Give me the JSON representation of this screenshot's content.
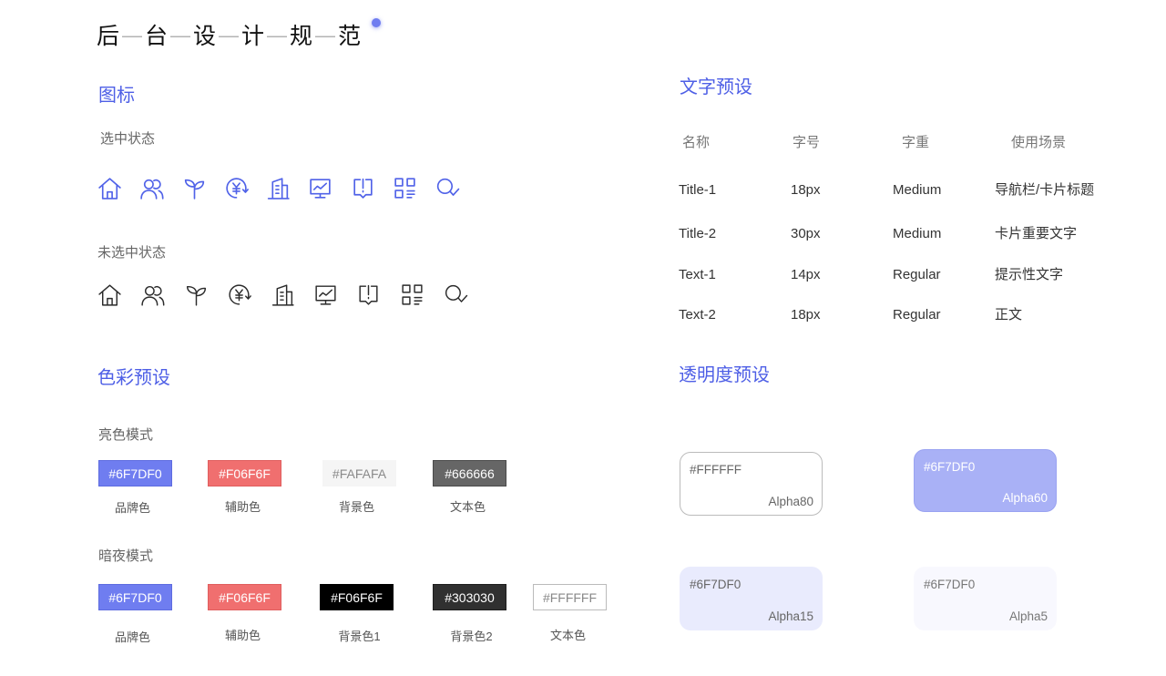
{
  "title": {
    "chars": [
      "后",
      "台",
      "设",
      "计",
      "规",
      "范"
    ],
    "separator": "—"
  },
  "colors": {
    "brand": "#6F7DF0",
    "heading": "#4E5FE6",
    "icon_selected": "#5062E8",
    "icon_unselected": "#2B2B2B"
  },
  "icons_section": {
    "heading": "图标",
    "selected_label": "选中状态",
    "unselected_label": "未选中状态",
    "selected": [
      "home-icon",
      "users-icon",
      "sprout-icon",
      "yen-refresh-icon",
      "building-icon",
      "monitor-chart-icon",
      "report-alert-icon",
      "grid-icon",
      "search-check-icon"
    ],
    "unselected": [
      "home-icon",
      "users-icon",
      "sprout-icon",
      "yen-refresh-icon",
      "building-icon",
      "monitor-chart-icon",
      "report-alert-icon",
      "grid-icon",
      "search-check-icon"
    ]
  },
  "color_section": {
    "heading": "色彩预设",
    "light": {
      "label": "亮色模式",
      "swatches": [
        {
          "hex": "#6F7DF0",
          "name": "品牌色",
          "fill": "#6F7DF0",
          "text_color": "#FFFFFF",
          "border": "#5E6CE0"
        },
        {
          "hex": "#F06F6F",
          "name": "辅助色",
          "fill": "#F06F6F",
          "text_color": "#FFFFFF",
          "border": "#E05E5E"
        },
        {
          "hex": "#FAFAFA",
          "name": "背景色",
          "fill": "#F5F5F5",
          "text_color": "#8A8A8A",
          "border": "#F5F5F5"
        },
        {
          "hex": "#666666",
          "name": "文本色",
          "fill": "#666666",
          "text_color": "#FFFFFF",
          "border": "#4A4A4A"
        }
      ]
    },
    "dark": {
      "label": "暗夜模式",
      "swatches": [
        {
          "hex": "#6F7DF0",
          "name": "品牌色",
          "fill": "#6F7DF0",
          "text_color": "#FFFFFF",
          "border": "#5E6CE0"
        },
        {
          "hex": "#F06F6F",
          "name": "辅助色",
          "fill": "#F06F6F",
          "text_color": "#FFFFFF",
          "border": "#E05E5E"
        },
        {
          "hex": "#F06F6F",
          "name": "背景色1",
          "fill": "#000000",
          "text_color": "#FFFFFF",
          "border": "#000000"
        },
        {
          "hex": "#303030",
          "name": "背景色2",
          "fill": "#303030",
          "text_color": "#FFFFFF",
          "border": "#1E1E1E"
        },
        {
          "hex": "#FFFFFF",
          "name": "文本色",
          "fill": "#FFFFFF",
          "text_color": "#888888",
          "border": "#BBBBBB"
        }
      ]
    }
  },
  "type_section": {
    "heading": "文字预设",
    "columns": [
      "名称",
      "字号",
      "字重",
      "使用场景"
    ],
    "rows": [
      [
        "Title-1",
        "18px",
        "Medium",
        "导航栏/卡片标题"
      ],
      [
        "Title-2",
        "30px",
        "Medium",
        "卡片重要文字"
      ],
      [
        "Text-1",
        "14px",
        "Regular",
        "提示性文字"
      ],
      [
        "Text-2",
        "18px",
        "Regular",
        "正文"
      ]
    ]
  },
  "alpha_section": {
    "heading": "透明度预设",
    "boxes": [
      {
        "hex": "#FFFFFF",
        "alpha": "Alpha80",
        "fill": "#FFFFFF",
        "border": "#BBBBBB",
        "text_color": "#666666"
      },
      {
        "hex": "#6F7DF0",
        "alpha": "Alpha60",
        "fill": "#A9B1F6",
        "border": "#9AA3F1",
        "text_color": "#FFFFFF"
      },
      {
        "hex": "#6F7DF0",
        "alpha": "Alpha15",
        "fill": "#E9EBFD",
        "border": "#E9EBFD",
        "text_color": "#666666"
      },
      {
        "hex": "#6F7DF0",
        "alpha": "Alpha5",
        "fill": "#F8F8FE",
        "border": "#F8F8FE",
        "text_color": "#777777"
      }
    ]
  }
}
